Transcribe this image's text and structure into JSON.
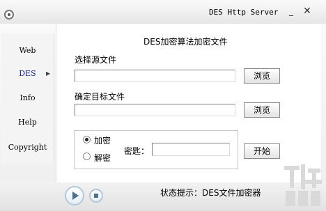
{
  "window": {
    "title": "DES Http Server",
    "minimize": "_",
    "close": "✕"
  },
  "sidebar": {
    "items": [
      {
        "label": "Web"
      },
      {
        "label": "DES",
        "active": true
      },
      {
        "label": "Info"
      },
      {
        "label": "Help"
      },
      {
        "label": "Copyright"
      }
    ]
  },
  "main": {
    "heading": "DES加密算法加密文件",
    "source_label": "选择源文件",
    "source_value": "",
    "target_label": "确定目标文件",
    "target_value": "",
    "browse_label": "浏览",
    "mode_encrypt": "加密",
    "mode_decrypt": "解密",
    "mode_selected": "encrypt",
    "key_label": "密匙：",
    "key_value": "",
    "start_label": "开始"
  },
  "status": {
    "text": "状态提示：DES文件加密器"
  },
  "colors": {
    "active_item": "#1a2b8a",
    "accent": "#4e6f8e"
  }
}
